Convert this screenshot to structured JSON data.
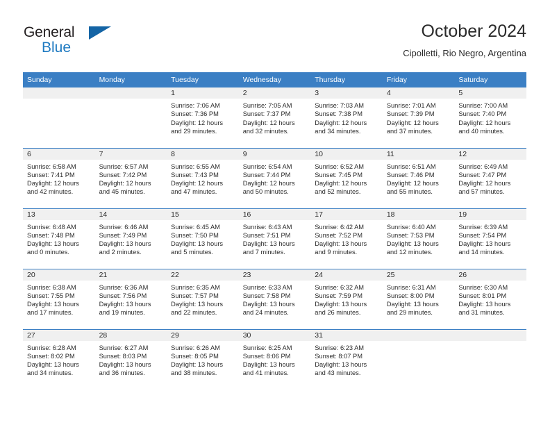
{
  "brand": {
    "name_line1": "General",
    "name_line2": "Blue",
    "triangle_icon": "triangle-icon",
    "color_dark": "#231f20",
    "color_blue": "#1e7ac1"
  },
  "header": {
    "title": "October 2024",
    "location": "Cipolletti, Rio Negro, Argentina"
  },
  "theme": {
    "header_bg": "#3b7fc4",
    "daynum_bg": "#f0f0f0",
    "row_divider": "#3b7fc4",
    "text": "#2b2b2b"
  },
  "weekdays": [
    "Sunday",
    "Monday",
    "Tuesday",
    "Wednesday",
    "Thursday",
    "Friday",
    "Saturday"
  ],
  "weeks": [
    [
      {
        "day": "",
        "empty": true
      },
      {
        "day": "",
        "empty": true
      },
      {
        "day": "1",
        "sunrise": "Sunrise: 7:06 AM",
        "sunset": "Sunset: 7:36 PM",
        "daylight1": "Daylight: 12 hours",
        "daylight2": "and 29 minutes."
      },
      {
        "day": "2",
        "sunrise": "Sunrise: 7:05 AM",
        "sunset": "Sunset: 7:37 PM",
        "daylight1": "Daylight: 12 hours",
        "daylight2": "and 32 minutes."
      },
      {
        "day": "3",
        "sunrise": "Sunrise: 7:03 AM",
        "sunset": "Sunset: 7:38 PM",
        "daylight1": "Daylight: 12 hours",
        "daylight2": "and 34 minutes."
      },
      {
        "day": "4",
        "sunrise": "Sunrise: 7:01 AM",
        "sunset": "Sunset: 7:39 PM",
        "daylight1": "Daylight: 12 hours",
        "daylight2": "and 37 minutes."
      },
      {
        "day": "5",
        "sunrise": "Sunrise: 7:00 AM",
        "sunset": "Sunset: 7:40 PM",
        "daylight1": "Daylight: 12 hours",
        "daylight2": "and 40 minutes."
      }
    ],
    [
      {
        "day": "6",
        "sunrise": "Sunrise: 6:58 AM",
        "sunset": "Sunset: 7:41 PM",
        "daylight1": "Daylight: 12 hours",
        "daylight2": "and 42 minutes."
      },
      {
        "day": "7",
        "sunrise": "Sunrise: 6:57 AM",
        "sunset": "Sunset: 7:42 PM",
        "daylight1": "Daylight: 12 hours",
        "daylight2": "and 45 minutes."
      },
      {
        "day": "8",
        "sunrise": "Sunrise: 6:55 AM",
        "sunset": "Sunset: 7:43 PM",
        "daylight1": "Daylight: 12 hours",
        "daylight2": "and 47 minutes."
      },
      {
        "day": "9",
        "sunrise": "Sunrise: 6:54 AM",
        "sunset": "Sunset: 7:44 PM",
        "daylight1": "Daylight: 12 hours",
        "daylight2": "and 50 minutes."
      },
      {
        "day": "10",
        "sunrise": "Sunrise: 6:52 AM",
        "sunset": "Sunset: 7:45 PM",
        "daylight1": "Daylight: 12 hours",
        "daylight2": "and 52 minutes."
      },
      {
        "day": "11",
        "sunrise": "Sunrise: 6:51 AM",
        "sunset": "Sunset: 7:46 PM",
        "daylight1": "Daylight: 12 hours",
        "daylight2": "and 55 minutes."
      },
      {
        "day": "12",
        "sunrise": "Sunrise: 6:49 AM",
        "sunset": "Sunset: 7:47 PM",
        "daylight1": "Daylight: 12 hours",
        "daylight2": "and 57 minutes."
      }
    ],
    [
      {
        "day": "13",
        "sunrise": "Sunrise: 6:48 AM",
        "sunset": "Sunset: 7:48 PM",
        "daylight1": "Daylight: 13 hours",
        "daylight2": "and 0 minutes."
      },
      {
        "day": "14",
        "sunrise": "Sunrise: 6:46 AM",
        "sunset": "Sunset: 7:49 PM",
        "daylight1": "Daylight: 13 hours",
        "daylight2": "and 2 minutes."
      },
      {
        "day": "15",
        "sunrise": "Sunrise: 6:45 AM",
        "sunset": "Sunset: 7:50 PM",
        "daylight1": "Daylight: 13 hours",
        "daylight2": "and 5 minutes."
      },
      {
        "day": "16",
        "sunrise": "Sunrise: 6:43 AM",
        "sunset": "Sunset: 7:51 PM",
        "daylight1": "Daylight: 13 hours",
        "daylight2": "and 7 minutes."
      },
      {
        "day": "17",
        "sunrise": "Sunrise: 6:42 AM",
        "sunset": "Sunset: 7:52 PM",
        "daylight1": "Daylight: 13 hours",
        "daylight2": "and 9 minutes."
      },
      {
        "day": "18",
        "sunrise": "Sunrise: 6:40 AM",
        "sunset": "Sunset: 7:53 PM",
        "daylight1": "Daylight: 13 hours",
        "daylight2": "and 12 minutes."
      },
      {
        "day": "19",
        "sunrise": "Sunrise: 6:39 AM",
        "sunset": "Sunset: 7:54 PM",
        "daylight1": "Daylight: 13 hours",
        "daylight2": "and 14 minutes."
      }
    ],
    [
      {
        "day": "20",
        "sunrise": "Sunrise: 6:38 AM",
        "sunset": "Sunset: 7:55 PM",
        "daylight1": "Daylight: 13 hours",
        "daylight2": "and 17 minutes."
      },
      {
        "day": "21",
        "sunrise": "Sunrise: 6:36 AM",
        "sunset": "Sunset: 7:56 PM",
        "daylight1": "Daylight: 13 hours",
        "daylight2": "and 19 minutes."
      },
      {
        "day": "22",
        "sunrise": "Sunrise: 6:35 AM",
        "sunset": "Sunset: 7:57 PM",
        "daylight1": "Daylight: 13 hours",
        "daylight2": "and 22 minutes."
      },
      {
        "day": "23",
        "sunrise": "Sunrise: 6:33 AM",
        "sunset": "Sunset: 7:58 PM",
        "daylight1": "Daylight: 13 hours",
        "daylight2": "and 24 minutes."
      },
      {
        "day": "24",
        "sunrise": "Sunrise: 6:32 AM",
        "sunset": "Sunset: 7:59 PM",
        "daylight1": "Daylight: 13 hours",
        "daylight2": "and 26 minutes."
      },
      {
        "day": "25",
        "sunrise": "Sunrise: 6:31 AM",
        "sunset": "Sunset: 8:00 PM",
        "daylight1": "Daylight: 13 hours",
        "daylight2": "and 29 minutes."
      },
      {
        "day": "26",
        "sunrise": "Sunrise: 6:30 AM",
        "sunset": "Sunset: 8:01 PM",
        "daylight1": "Daylight: 13 hours",
        "daylight2": "and 31 minutes."
      }
    ],
    [
      {
        "day": "27",
        "sunrise": "Sunrise: 6:28 AM",
        "sunset": "Sunset: 8:02 PM",
        "daylight1": "Daylight: 13 hours",
        "daylight2": "and 34 minutes."
      },
      {
        "day": "28",
        "sunrise": "Sunrise: 6:27 AM",
        "sunset": "Sunset: 8:03 PM",
        "daylight1": "Daylight: 13 hours",
        "daylight2": "and 36 minutes."
      },
      {
        "day": "29",
        "sunrise": "Sunrise: 6:26 AM",
        "sunset": "Sunset: 8:05 PM",
        "daylight1": "Daylight: 13 hours",
        "daylight2": "and 38 minutes."
      },
      {
        "day": "30",
        "sunrise": "Sunrise: 6:25 AM",
        "sunset": "Sunset: 8:06 PM",
        "daylight1": "Daylight: 13 hours",
        "daylight2": "and 41 minutes."
      },
      {
        "day": "31",
        "sunrise": "Sunrise: 6:23 AM",
        "sunset": "Sunset: 8:07 PM",
        "daylight1": "Daylight: 13 hours",
        "daylight2": "and 43 minutes."
      },
      {
        "day": "",
        "empty": true
      },
      {
        "day": "",
        "empty": true
      }
    ]
  ]
}
